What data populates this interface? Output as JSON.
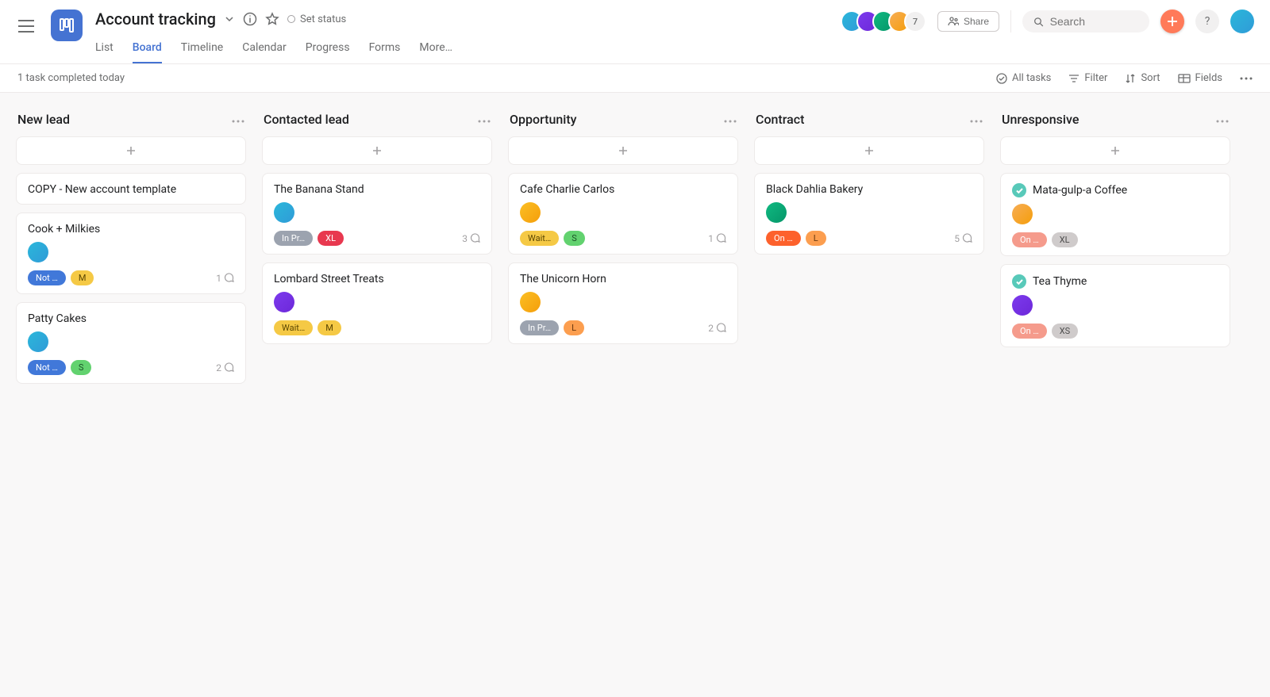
{
  "header": {
    "title": "Account tracking",
    "set_status": "Set status",
    "share": "Share",
    "search_placeholder": "Search",
    "help": "?",
    "member_overflow": "7",
    "tabs": [
      "List",
      "Board",
      "Timeline",
      "Calendar",
      "Progress",
      "Forms",
      "More…"
    ],
    "active_tab_index": 1
  },
  "subbar": {
    "status": "1 task completed today",
    "all_tasks": "All tasks",
    "filter": "Filter",
    "sort": "Sort",
    "fields": "Fields"
  },
  "columns": [
    {
      "title": "New lead",
      "cards": [
        {
          "title": "COPY - New account template",
          "done": false,
          "tags": [],
          "comments": null,
          "assignee": null
        },
        {
          "title": "Cook + Milkies",
          "done": false,
          "assignee": "bg-a",
          "tags": [
            {
              "text": "Not …",
              "cls": "blue"
            },
            {
              "text": "M",
              "cls": "yellow"
            }
          ],
          "comments": 1
        },
        {
          "title": "Patty Cakes",
          "done": false,
          "assignee": "bg-a",
          "tags": [
            {
              "text": "Not …",
              "cls": "blue"
            },
            {
              "text": "S",
              "cls": "green"
            }
          ],
          "comments": 2
        }
      ]
    },
    {
      "title": "Contacted lead",
      "cards": [
        {
          "title": "The Banana Stand",
          "done": false,
          "assignee": "bg-a",
          "tags": [
            {
              "text": "In Pr…",
              "cls": "gray"
            },
            {
              "text": "XL",
              "cls": "red"
            }
          ],
          "comments": 3
        },
        {
          "title": "Lombard Street Treats",
          "done": false,
          "assignee": "bg-c",
          "tags": [
            {
              "text": "Wait…",
              "cls": "yellow"
            },
            {
              "text": "M",
              "cls": "yellow"
            }
          ],
          "comments": null
        }
      ]
    },
    {
      "title": "Opportunity",
      "cards": [
        {
          "title": "Cafe Charlie Carlos",
          "done": false,
          "assignee": "bg-f",
          "tags": [
            {
              "text": "Wait…",
              "cls": "yellow"
            },
            {
              "text": "S",
              "cls": "green"
            }
          ],
          "comments": 1
        },
        {
          "title": "The Unicorn Horn",
          "done": false,
          "assignee": "bg-f",
          "tags": [
            {
              "text": "In Pr…",
              "cls": "gray"
            },
            {
              "text": "L",
              "cls": "orange"
            }
          ],
          "comments": 2
        }
      ]
    },
    {
      "title": "Contract",
      "cards": [
        {
          "title": "Black Dahlia Bakery",
          "done": false,
          "assignee": "bg-e",
          "tags": [
            {
              "text": "On …",
              "cls": "orange2"
            },
            {
              "text": "L",
              "cls": "orange"
            }
          ],
          "comments": 5
        }
      ]
    },
    {
      "title": "Unresponsive",
      "cards": [
        {
          "title": "Mata-gulp-a Coffee",
          "done": true,
          "assignee": "bg-b",
          "tags": [
            {
              "text": "On …",
              "cls": "coral"
            },
            {
              "text": "XL",
              "cls": "slate"
            }
          ],
          "comments": null
        },
        {
          "title": "Tea Thyme",
          "done": true,
          "assignee": "bg-c",
          "tags": [
            {
              "text": "On …",
              "cls": "coral"
            },
            {
              "text": "XS",
              "cls": "slate"
            }
          ],
          "comments": null
        }
      ]
    }
  ]
}
